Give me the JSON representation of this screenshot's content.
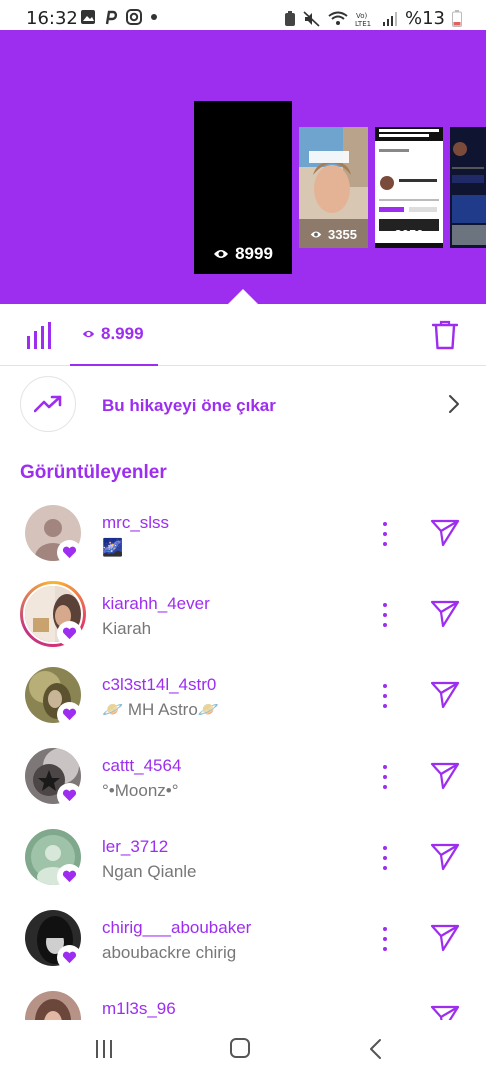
{
  "status_bar": {
    "time": "16:32",
    "battery": "%13",
    "icons": [
      "gallery-icon",
      "pinterest-icon",
      "instagram-icon",
      "dot-icon",
      "battery-saver-icon",
      "mute-icon",
      "wifi-icon",
      "volte-icon",
      "signal-icon",
      "battery-icon"
    ]
  },
  "story_thumbs": [
    {
      "views": "8999"
    },
    {
      "views": "3355"
    },
    {
      "views": "2050"
    },
    {
      "views": ""
    }
  ],
  "tabs": {
    "views_count": "8.999"
  },
  "promote": {
    "label": "Bu hikayeyi öne çıkar"
  },
  "viewers_title": "Görüntüleyenler",
  "viewers": [
    {
      "username": "mrc_slss",
      "subtitle": "🌌"
    },
    {
      "username": "kiarahh_4ever",
      "subtitle": "Kiarah"
    },
    {
      "username": "c3l3st14l_4str0",
      "subtitle": "🪐 MH Astro🪐"
    },
    {
      "username": "cattt_4564",
      "subtitle": "°•Moonz•°"
    },
    {
      "username": "ler_3712",
      "subtitle": "Ngan Qianle"
    },
    {
      "username": "chirig___aboubaker",
      "subtitle": "aboubackre chirig"
    },
    {
      "username": "m1l3s_96",
      "subtitle": ""
    }
  ],
  "colors": {
    "accent": "#9d2ef0",
    "secondary_text": "#777777"
  }
}
